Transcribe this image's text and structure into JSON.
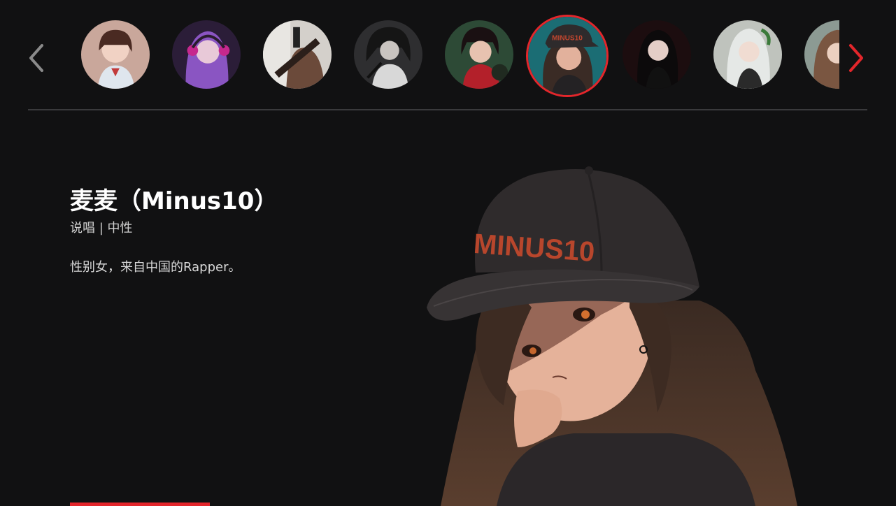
{
  "carousel": {
    "prev_icon": "chevron-left-icon",
    "next_icon": "chevron-right-icon",
    "accent_color": "#e3262b",
    "inactive_arrow_color": "#8a8a8a",
    "selected_index": 5,
    "avatars": [
      {
        "name": "avatar-girl-schoolgirl",
        "bg": "#c9a79b"
      },
      {
        "name": "avatar-purple-hair-headphones",
        "bg": "#4a2d63"
      },
      {
        "name": "avatar-guitarist",
        "bg": "#6b5a4e"
      },
      {
        "name": "avatar-singer-microphone",
        "bg": "#3b3b3d"
      },
      {
        "name": "avatar-boy-red-scarf",
        "bg": "#2d4a36"
      },
      {
        "name": "avatar-minus10",
        "bg": "#1b6d74"
      },
      {
        "name": "avatar-dark-hair-woman",
        "bg": "#2a1416"
      },
      {
        "name": "avatar-silver-hair",
        "bg": "#b9bdb9"
      },
      {
        "name": "avatar-long-hair-partial",
        "bg": "#7d8c86"
      }
    ]
  },
  "artist": {
    "name": "麦麦（Minus10）",
    "tags": "说唱 | 中性",
    "description": "性别女，来自中国的Rapper。",
    "cap_text": "MINUS10"
  }
}
